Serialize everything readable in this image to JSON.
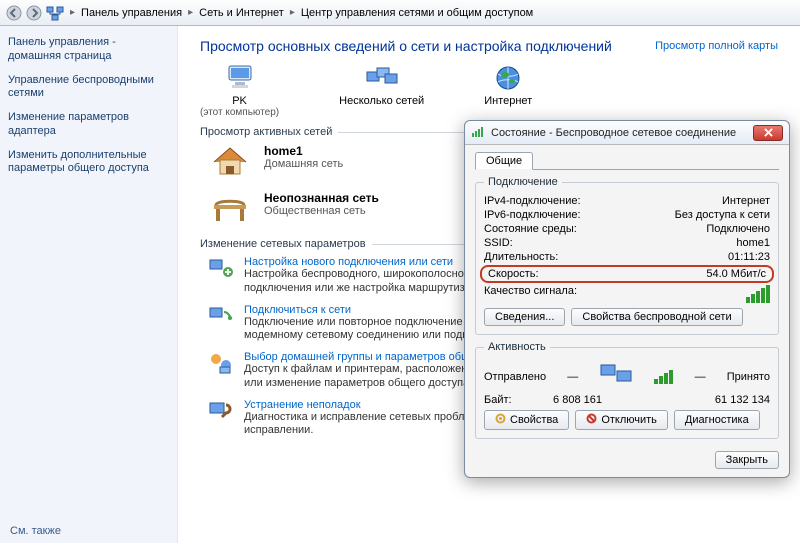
{
  "breadcrumb": {
    "items": [
      "Панель управления",
      "Сеть и Интернет",
      "Центр управления сетями и общим доступом"
    ]
  },
  "sidebar": {
    "items": [
      "Панель управления - домашняя страница",
      "Управление беспроводными сетями",
      "Изменение параметров адаптера",
      "Изменить дополнительные параметры общего доступа"
    ],
    "see_also": "См. также"
  },
  "content": {
    "title": "Просмотр основных сведений о сети и настройка подключений",
    "full_map_link": "Просмотр полной карты",
    "map": {
      "pc": "PK",
      "pc_sub": "(этот компьютер)",
      "multi": "Несколько сетей",
      "internet": "Интернет"
    },
    "section_active": "Просмотр активных сетей",
    "net1": {
      "name": "home1",
      "type": "Домашняя сеть"
    },
    "net2": {
      "name": "Неопознанная сеть",
      "type": "Общественная сеть"
    },
    "section_params": "Изменение сетевых параметров",
    "tasks": [
      {
        "link": "Настройка нового подключения или сети",
        "desc": "Настройка беспроводного, широкополосного, модемного, прямого или VPN-подключения или же настройка маршрутизатора или точки доступа."
      },
      {
        "link": "Подключиться к сети",
        "desc": "Подключение или повторное подключение к беспроводному, проводному, модемному сетевому соединению или подключение к VPN."
      },
      {
        "link": "Выбор домашней группы и параметров общего доступа",
        "desc": "Доступ к файлам и принтерам, расположенным на других сетевых компьютерах, или изменение параметров общего доступа."
      },
      {
        "link": "Устранение неполадок",
        "desc": "Диагностика и исправление сетевых проблем или получение сведений об исправлении."
      }
    ]
  },
  "dialog": {
    "title": "Состояние - Беспроводное сетевое соединение",
    "tab": "Общие",
    "group_conn": "Подключение",
    "rows": {
      "ipv4_l": "IPv4-подключение:",
      "ipv4_v": "Интернет",
      "ipv6_l": "IPv6-подключение:",
      "ipv6_v": "Без доступа к сети",
      "media_l": "Состояние среды:",
      "media_v": "Подключено",
      "ssid_l": "SSID:",
      "ssid_v": "home1",
      "dur_l": "Длительность:",
      "dur_v": "01:11:23",
      "speed_l": "Скорость:",
      "speed_v": "54.0 Мбит/с",
      "sig_l": "Качество сигнала:"
    },
    "btn_details": "Сведения...",
    "btn_wprops": "Свойства беспроводной сети",
    "group_act": "Активность",
    "sent": "Отправлено",
    "recv": "Принято",
    "bytes_l": "Байт:",
    "sent_v": "6 808 161",
    "recv_v": "61 132 134",
    "btn_props": "Свойства",
    "btn_disable": "Отключить",
    "btn_diag": "Диагностика",
    "btn_close": "Закрыть"
  }
}
